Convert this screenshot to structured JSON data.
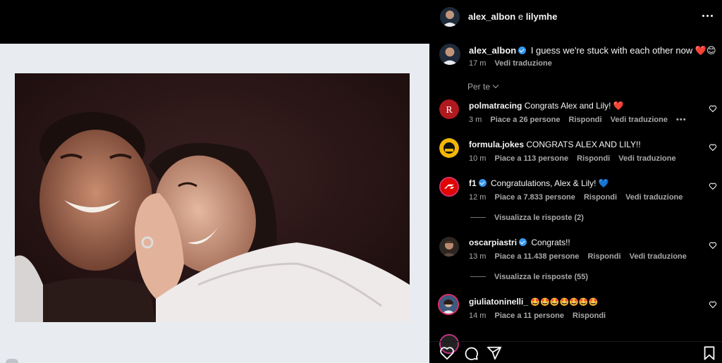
{
  "header": {
    "user": "alex_albon",
    "joiner": "e",
    "coauthor": "lilymhe",
    "more_icon": "more-horizontal-icon"
  },
  "caption": {
    "username": "alex_albon",
    "verified": true,
    "text": "I guess we're stuck with each other now ❤️😊",
    "time": "17 m",
    "translate": "Vedi traduzione"
  },
  "filter": {
    "label": "Per te"
  },
  "comments": [
    {
      "username": "polmatracing",
      "verified": false,
      "text": "Congrats Alex and Lily! ❤️",
      "time": "3 m",
      "likes": "Piace a 26 persone",
      "reply": "Rispondi",
      "translate": "Vedi traduzione",
      "more": "•••",
      "avatar_color": "#b0191e"
    },
    {
      "username": "formula.jokes",
      "verified": false,
      "text": "CONGRATS ALEX AND LILY!!",
      "time": "10 m",
      "likes": "Piace a 113 persone",
      "reply": "Rispondi",
      "translate": "Vedi traduzione",
      "avatar_color": "#f2b705"
    },
    {
      "username": "f1",
      "verified": true,
      "text": "Congratulations, Alex & Lily! 💙",
      "time": "12 m",
      "likes": "Piace a 7.833 persone",
      "reply": "Rispondi",
      "translate": "Vedi traduzione",
      "avatar_color": "#e10600",
      "view_replies": "Visualizza le risposte (2)"
    },
    {
      "username": "oscarpiastri",
      "verified": true,
      "text": "Congrats!!",
      "time": "13 m",
      "likes": "Piace a 11.438 persone",
      "reply": "Rispondi",
      "translate": "Vedi traduzione",
      "avatar_color": "#6b4a3a",
      "view_replies": "Visualizza le risposte (55)"
    },
    {
      "username": "giuliatoninelli_",
      "verified": false,
      "text": "🤩🤩🤩🤩🤩🤩🤩",
      "time": "14 m",
      "likes": "Piace a 11 persone",
      "reply": "Rispondi",
      "avatar_color": "#3d5a80"
    }
  ],
  "actions": {
    "like_icon": "heart-icon",
    "comment_icon": "comment-icon",
    "share_icon": "share-icon",
    "save_icon": "bookmark-icon"
  },
  "colors": {
    "background": "#000000",
    "text": "#f5f5f5",
    "secondary": "#a8a8a8",
    "verified": "#3897f0",
    "polaroid_frame": "#e8ecf1"
  }
}
